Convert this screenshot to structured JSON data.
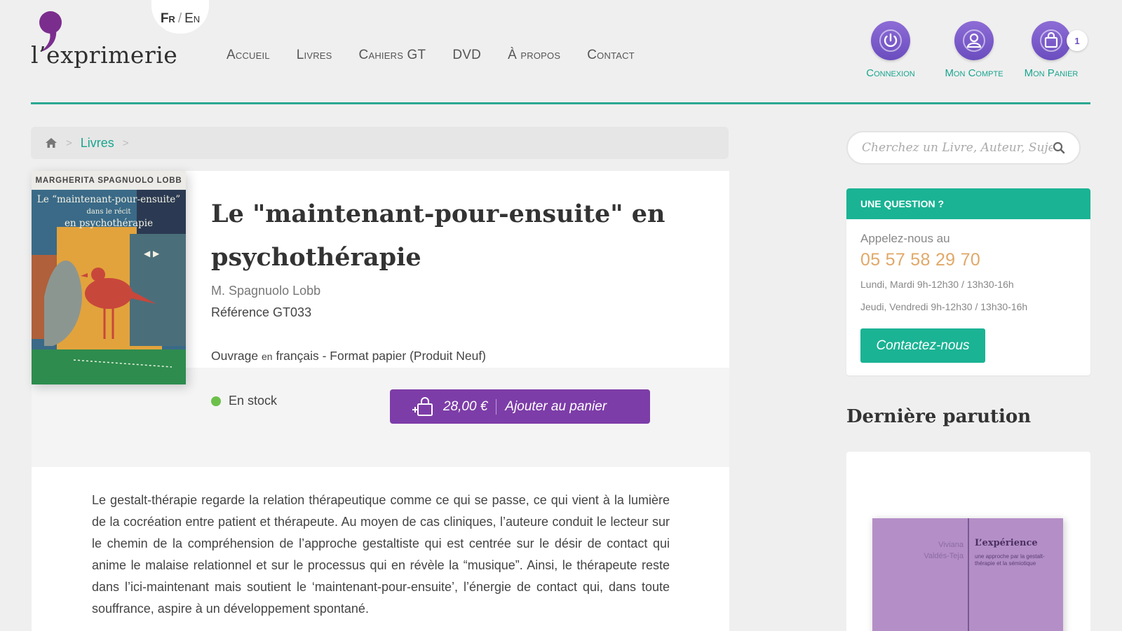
{
  "header": {
    "logo_text": "l’exprimerie",
    "lang": {
      "fr": "Fr",
      "sep": "/",
      "en": "En"
    },
    "nav": [
      "Accueil",
      "Livres",
      "Cahiers GT",
      "DVD",
      "À propos",
      "Contact"
    ],
    "account": {
      "login_label": "Connexion",
      "account_label": "Mon Compte",
      "cart_label": "Mon Panier",
      "cart_count": "1"
    }
  },
  "breadcrumb": {
    "home_icon": "home-icon",
    "items": [
      "Livres"
    ]
  },
  "product": {
    "cover": {
      "author": "MARGHERITA SPAGNUOLO LOBB",
      "title_line1": "Le “maintenant-pour-ensuite”",
      "title_line2": "dans le récit",
      "title_line3": "en psychothérapie"
    },
    "title_line1": "Le \"maintenant-pour-ensuite\" en",
    "title_line2": "psychothérapie",
    "author": "M. Spagnuolo Lobb",
    "reference": "Référence GT033",
    "format_part1": "Ouvrage",
    "format_part2": "en",
    "format_part3": "français - Format papier (Produit Neuf)",
    "stock": "En stock",
    "stock_color": "#6cc04a",
    "price": "28,00 €",
    "add_label": "Ajouter au panier",
    "button_color": "#7d3da8",
    "description": "Le gestalt-thérapie regarde la relation thérapeutique comme ce qui se passe, ce qui vient à la lumière de la cocréation entre patient et thérapeute. Au moyen de cas cliniques, l’auteure conduit le lecteur sur le chemin de la compréhension de l’approche gestaltiste qui est centrée sur le désir de contact qui anime le malaise relationnel et sur le processus qui en révèle la “musique”. Ainsi, le thérapeute reste dans l’ici-maintenant mais soutient le ‘maintenant-pour-ensuite’, l’énergie de contact qui, dans toute souffrance, aspire à un développement spontané."
  },
  "sidebar": {
    "search_placeholder": "Cherchez un Livre, Auteur, Sujet",
    "question": {
      "heading": "UNE QUESTION ?",
      "lead": "Appelez-nous au",
      "phone": "05 57 58 29 70",
      "hours1": "Lundi, Mardi 9h-12h30 / 13h30-16h",
      "hours2": "Jeudi, Vendredi 9h-12h30 / 13h30-16h",
      "button": "Contactez-nous",
      "accent_color": "#1ab394"
    },
    "latest": {
      "title": "Dernière parution",
      "cover_author_line1": "Viviana",
      "cover_author_line2": "Valdés-Teja",
      "cover_title": "L’expérience",
      "cover_subtitle": "une approche par la gestalt-thérapie et la sémiotique"
    }
  },
  "colors": {
    "teal": "#2aa893",
    "purple": "#6b4dbf",
    "phone": "#e0a869"
  }
}
